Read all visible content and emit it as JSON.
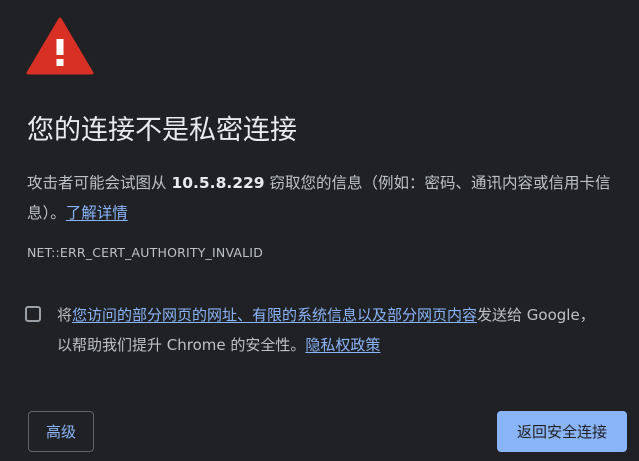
{
  "icon": {
    "name": "warning-triangle-icon",
    "color": "#d93025"
  },
  "title": "您的连接不是私密连接",
  "body": {
    "prefix": "攻击者可能会试图从 ",
    "host": "10.5.8.229",
    "suffix": " 窃取您的信息（例如：密码、通讯内容或信用卡信息）。",
    "learn_more": "了解详情"
  },
  "error_code": "NET::ERR_CERT_AUTHORITY_INVALID",
  "optin": {
    "checked": false,
    "prefix": "将",
    "link": "您访问的部分网页的网址、有限的系统信息以及部分网页内容",
    "middle": "发送给 Google，以帮助我们提升 Chrome 的安全性。",
    "privacy_link": "隐私权政策"
  },
  "buttons": {
    "advanced": "高级",
    "back_to_safety": "返回安全连接"
  },
  "colors": {
    "background": "#202124",
    "title": "#e8eaed",
    "text": "#bdc1c6",
    "link": "#8ab4f8",
    "primary_button": "#8ab4f8"
  }
}
